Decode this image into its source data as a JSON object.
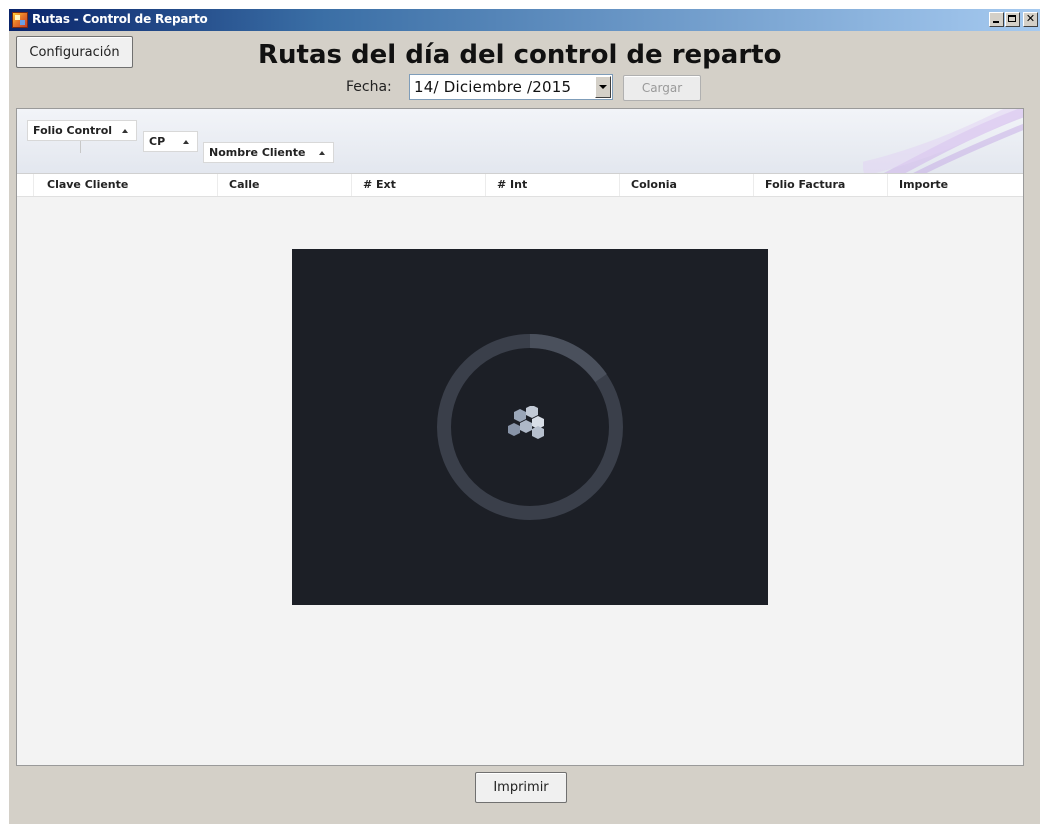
{
  "window": {
    "title": "Rutas - Control de Reparto"
  },
  "toolbar": {
    "config_label": "Configuración",
    "page_title": "Rutas del día del control de reparto",
    "fecha_label": "Fecha:",
    "date_value": "14/ Diciembre /2015",
    "cargar_label": "Cargar"
  },
  "grid": {
    "group_by": [
      "Folio Control",
      "CP",
      "Nombre Cliente"
    ],
    "columns": [
      "Clave Cliente",
      "Calle",
      "# Ext",
      "# Int",
      "Colonia",
      "Folio Factura",
      "Importe"
    ],
    "rows": []
  },
  "footer": {
    "print_label": "Imprimir"
  },
  "colors": {
    "window_bg": "#d4d0c8",
    "titlebar_start": "#0a246a",
    "titlebar_end": "#a6caf0",
    "loader_bg": "#1c1f26",
    "grid_bg": "#f3f3f3"
  },
  "icons": {
    "app": "app-icon",
    "loading": "loading-spinner-icon"
  }
}
